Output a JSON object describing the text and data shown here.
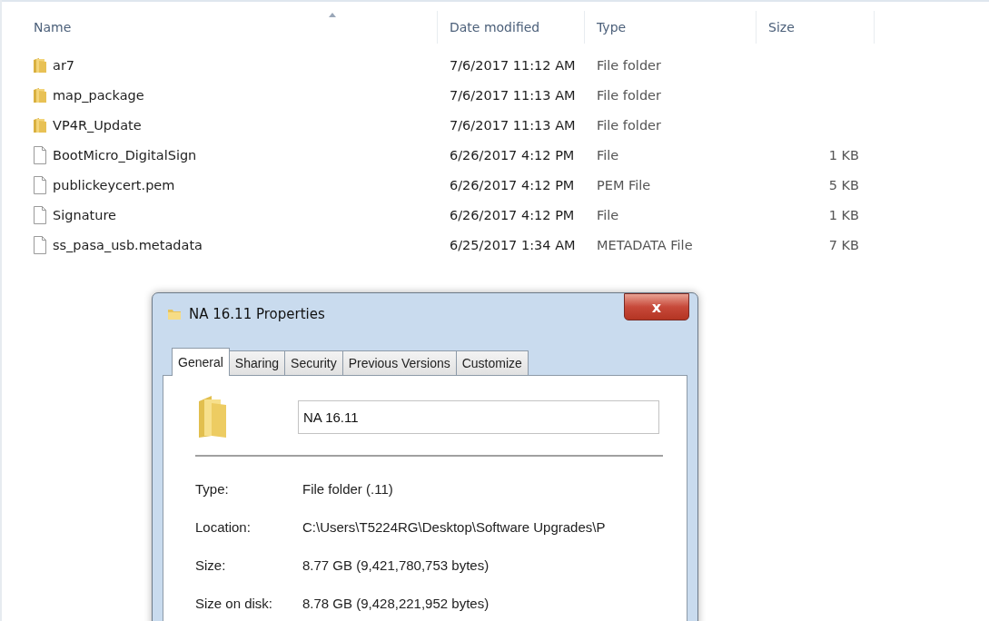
{
  "file_list": {
    "columns": [
      {
        "label": "Name",
        "sorted": true
      },
      {
        "label": "Date modified",
        "sorted": false
      },
      {
        "label": "Type",
        "sorted": false
      },
      {
        "label": "Size",
        "sorted": false
      }
    ],
    "rows": [
      {
        "kind": "folder",
        "name": "ar7",
        "date": "7/6/2017 11:12 AM",
        "type": "File folder"
      },
      {
        "kind": "folder",
        "name": "map_package",
        "date": "7/6/2017 11:13 AM",
        "type": "File folder"
      },
      {
        "kind": "folder",
        "name": "VP4R_Update",
        "date": "7/6/2017 11:13 AM",
        "type": "File folder"
      },
      {
        "kind": "file",
        "name": "BootMicro_DigitalSign",
        "date": "6/26/2017 4:12 PM",
        "type": "File",
        "size": "1 KB"
      },
      {
        "kind": "file",
        "name": "publickeycert.pem",
        "date": "6/26/2017 4:12 PM",
        "type": "PEM File",
        "size": "5 KB"
      },
      {
        "kind": "file",
        "name": "Signature",
        "date": "6/26/2017 4:12 PM",
        "type": "File",
        "size": "1 KB"
      },
      {
        "kind": "file",
        "name": "ss_pasa_usb.metadata",
        "date": "6/25/2017 1:34 AM",
        "type": "METADATA File",
        "size": "7 KB"
      }
    ]
  },
  "dialog": {
    "title": "NA 16.11 Properties",
    "close": "x",
    "tabs": [
      {
        "label": "General",
        "selected": true
      },
      {
        "label": "Sharing",
        "selected": false
      },
      {
        "label": "Security",
        "selected": false
      },
      {
        "label": "Previous Versions",
        "selected": false
      },
      {
        "label": "Customize",
        "selected": false
      }
    ],
    "name_value": "NA 16.11",
    "properties": [
      {
        "label": "Type:",
        "value": "File folder (.11)"
      },
      {
        "label": "Location:",
        "value": "C:\\Users\\T5224RG\\Desktop\\Software Upgrades\\P"
      },
      {
        "label": "Size:",
        "value": "8.77 GB (9,421,780,753 bytes)"
      },
      {
        "label": "Size on disk:",
        "value": "8.78 GB (9,428,221,952 bytes)"
      }
    ]
  }
}
